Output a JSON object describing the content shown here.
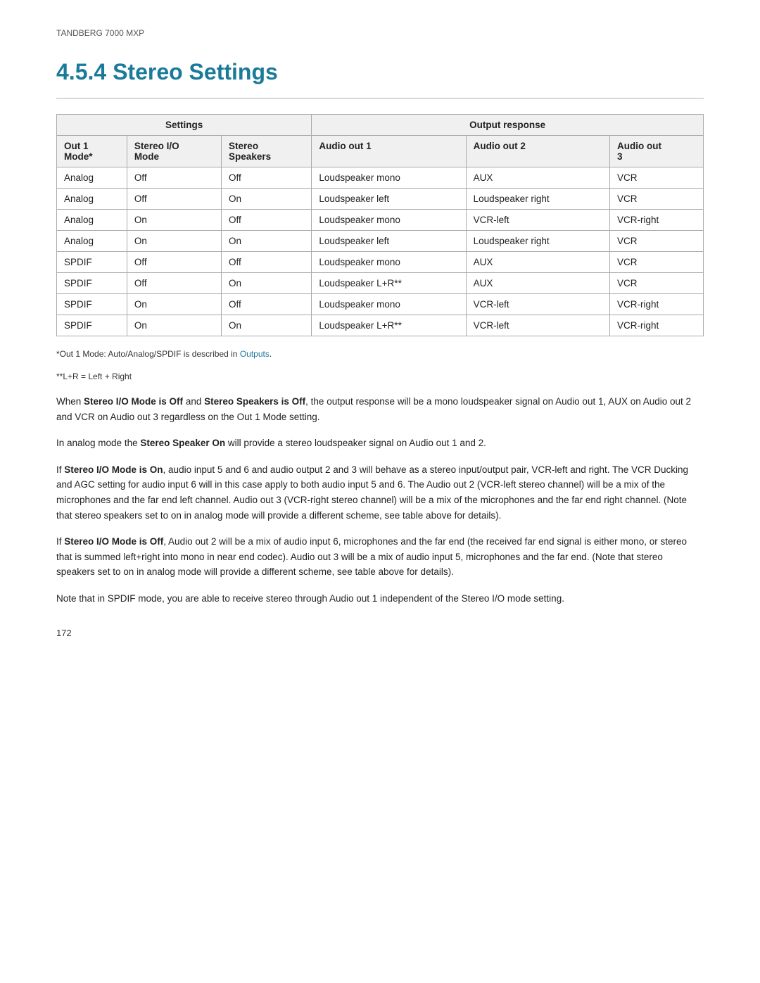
{
  "header": {
    "label": "TANDBERG 7000 MXP"
  },
  "title": "4.5.4   Stereo Settings",
  "table": {
    "group_headers": [
      {
        "label": "Settings",
        "colspan": 3
      },
      {
        "label": "Output response",
        "colspan": 3
      }
    ],
    "col_headers": [
      {
        "label": "Out 1\nMode*"
      },
      {
        "label": "Stereo I/O\nMode"
      },
      {
        "label": "Stereo\nSpeakers"
      },
      {
        "label": "Audio out 1"
      },
      {
        "label": "Audio out 2"
      },
      {
        "label": "Audio out\n3"
      }
    ],
    "rows": [
      [
        "Analog",
        "Off",
        "Off",
        "Loudspeaker mono",
        "AUX",
        "VCR"
      ],
      [
        "Analog",
        "Off",
        "On",
        "Loudspeaker left",
        "Loudspeaker right",
        "VCR"
      ],
      [
        "Analog",
        "On",
        "Off",
        "Loudspeaker mono",
        "VCR-left",
        "VCR-right"
      ],
      [
        "Analog",
        "On",
        "On",
        "Loudspeaker left",
        "Loudspeaker right",
        "VCR"
      ],
      [
        "SPDIF",
        "Off",
        "Off",
        "Loudspeaker mono",
        "AUX",
        "VCR"
      ],
      [
        "SPDIF",
        "Off",
        "On",
        "Loudspeaker L+R**",
        "AUX",
        "VCR"
      ],
      [
        "SPDIF",
        "On",
        "Off",
        "Loudspeaker mono",
        "VCR-left",
        "VCR-right"
      ],
      [
        "SPDIF",
        "On",
        "On",
        "Loudspeaker L+R**",
        "VCR-left",
        "VCR-right"
      ]
    ]
  },
  "footnotes": [
    "*Out 1 Mode: Auto/Analog/SPDIF is described in Outputs.",
    "**L+R = Left + Right"
  ],
  "paragraphs": [
    "When <b>Stereo I/O Mode is Off</b> and <b>Stereo Speakers is Off</b>, the output response will be a mono loudspeaker signal on Audio out 1, AUX on Audio out 2 and VCR on Audio out 3 regardless on the Out 1 Mode setting.",
    "In analog mode the <b>Stereo Speaker On</b> will provide a stereo loudspeaker signal on Audio out 1 and 2.",
    "If <b>Stereo I/O Mode is On</b>, audio input 5 and 6 and audio output 2 and 3 will behave as a stereo input/output pair, VCR-left and right. The VCR Ducking and AGC setting for audio input 6 will in this case apply to both audio input 5 and 6. The Audio out 2 (VCR-left stereo channel) will be a mix of the microphones and the far end left channel. Audio out 3 (VCR-right stereo channel) will be a mix of the microphones and the far end right channel. (Note that stereo speakers set to on in analog mode will provide a different scheme, see table above for details).",
    "If <b>Stereo I/O Mode is Off</b>, Audio out 2 will be a mix of audio input 6, microphones and the far end (the received far end signal is either mono, or stereo that is summed left+right into mono in near end codec). Audio out 3 will be a mix of audio input 5, microphones and the far end. (Note that stereo speakers set to on in analog mode will provide a different scheme, see table above for details).",
    "Note that in SPDIF mode, you are able to receive stereo through Audio out 1 independent of the Stereo I/O mode setting."
  ],
  "page_number": "172"
}
